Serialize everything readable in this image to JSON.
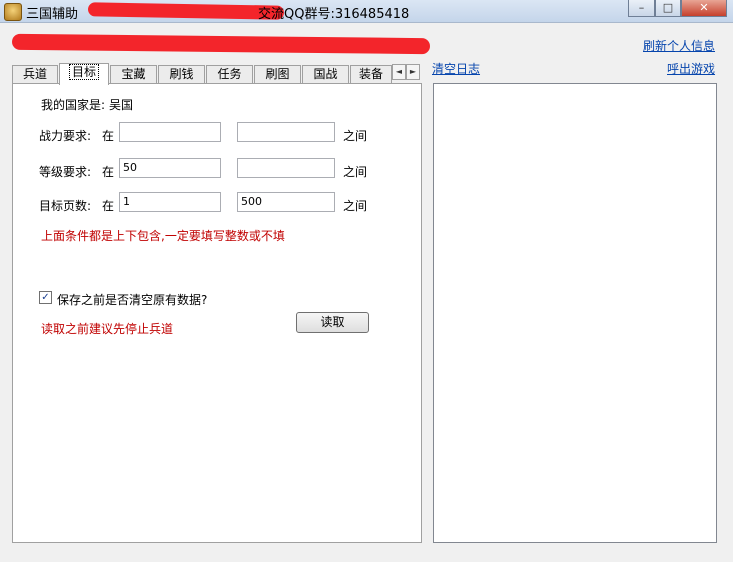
{
  "titlebar": {
    "title_prefix": "三国辅助",
    "title_suffix": "交流QQ群号:316485418",
    "minimize": "–",
    "maximize": "□",
    "close": "✕"
  },
  "header": {
    "refresh_link": "刷新个人信息",
    "clear_log_link": "清空日志",
    "summon_game_link": "呼出游戏"
  },
  "tabs": [
    {
      "label": "兵道"
    },
    {
      "label": "目标"
    },
    {
      "label": "宝藏"
    },
    {
      "label": "刷钱"
    },
    {
      "label": "任务"
    },
    {
      "label": "刷图"
    },
    {
      "label": "国战"
    },
    {
      "label": "装备"
    }
  ],
  "tab_scroll": {
    "left": "◄",
    "right": "►"
  },
  "target_panel": {
    "country_label": "我的国家是:",
    "country_value": "吴国",
    "power_label": "战力要求:",
    "power_in": "在",
    "power_min": "",
    "power_max": "",
    "power_between": "之间",
    "level_label": "等级要求:",
    "level_in": "在",
    "level_min": "50",
    "level_max": "",
    "level_between": "之间",
    "pages_label": "目标页数:",
    "pages_in": "在",
    "pages_min": "1",
    "pages_max": "500",
    "pages_between": "之间",
    "note": "上面条件都是上下包含,一定要填写整数或不填",
    "clear_checkbox_label": "保存之前是否清空原有数据?",
    "clear_checkbox_checked": true,
    "read_note": "读取之前建议先停止兵道",
    "read_button": "读取"
  }
}
